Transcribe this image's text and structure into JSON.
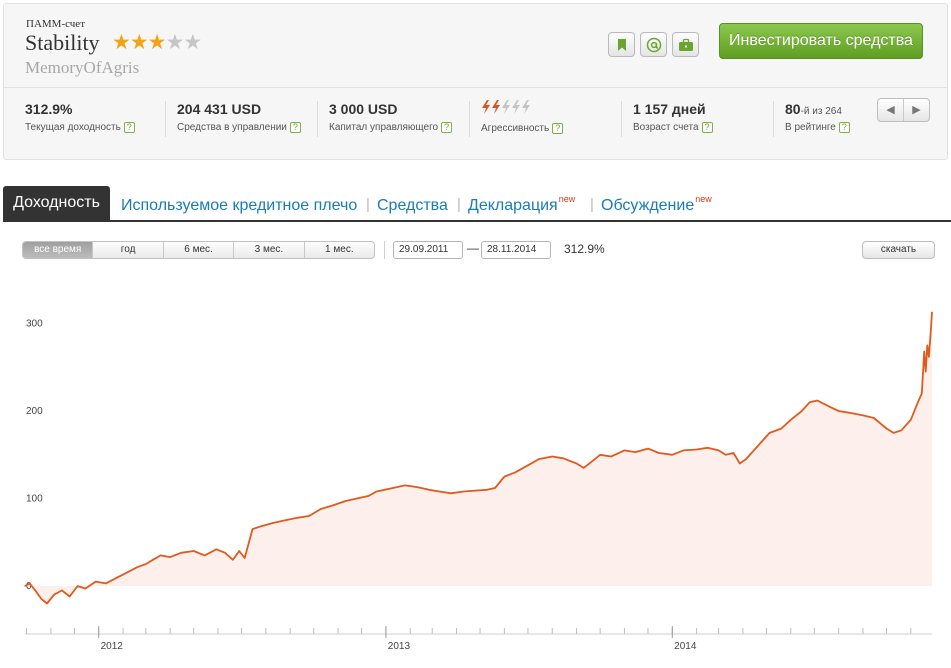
{
  "account": {
    "type_label": "ПАММ-счет",
    "name": "Stability",
    "rating_stars": 3,
    "rating_max": 5,
    "owner": "MemoryOfAgris"
  },
  "actions": {
    "invest_label": "Инвестировать средства",
    "icons": [
      "bookmark-icon",
      "at-icon",
      "briefcase-icon"
    ]
  },
  "metrics": [
    {
      "value": "312.9%",
      "label": "Текущая доходность"
    },
    {
      "value": "204 431 USD",
      "label": "Средства в управлении"
    },
    {
      "value": "3 000 USD",
      "label": "Капитал управляющего"
    },
    {
      "value": "",
      "label": "Агрессивность",
      "aggressiveness_level": 2,
      "aggressiveness_max": 5
    },
    {
      "value": "1 157 дней",
      "label": "Возраст счета"
    },
    {
      "value": "80",
      "value_suffix": "-й из 264",
      "label": "В рейтинге"
    }
  ],
  "pager": {
    "prev": "◀",
    "next": "▶"
  },
  "tabs": {
    "active": "Доходность",
    "items": [
      {
        "label": "Используемое кредитное плечо",
        "badge": ""
      },
      {
        "label": "Средства",
        "badge": ""
      },
      {
        "label": "Декларация",
        "badge": "new"
      },
      {
        "label": "Обсуждение",
        "badge": "new"
      }
    ]
  },
  "controls": {
    "periods": [
      "все время",
      "год",
      "6 мес.",
      "3 мес.",
      "1 мес."
    ],
    "active_period": "все время",
    "date_from": "29.09.2011",
    "date_to": "28.11.2014",
    "date_separator": "—",
    "range_yield": "312.9%",
    "download_label": "скачать"
  },
  "colors": {
    "accent_green": "#6aa52f",
    "line": "#e05a1e",
    "area": "#fdf0ec",
    "link": "#1a7bb9",
    "star_on": "#f0a418",
    "aggr_on": "#d9541e"
  },
  "chart_data": {
    "type": "area",
    "x_unit": "date",
    "y_unit": "%",
    "xlim": [
      "2011-09-29",
      "2014-11-28"
    ],
    "ylim": [
      -50,
      340
    ],
    "y_ticks": [
      0,
      100,
      200,
      300
    ],
    "x_ticks": [
      {
        "label": "2012",
        "date": "2012-01-01"
      },
      {
        "label": "2013",
        "date": "2013-01-01"
      },
      {
        "label": "2014",
        "date": "2014-01-01"
      }
    ],
    "grid": false,
    "legend": "none",
    "series": [
      {
        "points": [
          [
            "2011-09-29",
            0
          ],
          [
            "2011-10-05",
            3
          ],
          [
            "2011-10-12",
            -5
          ],
          [
            "2011-10-20",
            -15
          ],
          [
            "2011-10-27",
            -20
          ],
          [
            "2011-11-05",
            -10
          ],
          [
            "2011-11-15",
            -5
          ],
          [
            "2011-11-25",
            -12
          ],
          [
            "2011-12-05",
            0
          ],
          [
            "2011-12-15",
            -3
          ],
          [
            "2011-12-28",
            5
          ],
          [
            "2012-01-10",
            3
          ],
          [
            "2012-01-25",
            10
          ],
          [
            "2012-02-05",
            15
          ],
          [
            "2012-02-20",
            22
          ],
          [
            "2012-03-01",
            25
          ],
          [
            "2012-03-10",
            30
          ],
          [
            "2012-03-20",
            35
          ],
          [
            "2012-04-01",
            33
          ],
          [
            "2012-04-15",
            38
          ],
          [
            "2012-05-01",
            40
          ],
          [
            "2012-05-15",
            35
          ],
          [
            "2012-05-30",
            42
          ],
          [
            "2012-06-10",
            38
          ],
          [
            "2012-06-20",
            30
          ],
          [
            "2012-06-28",
            40
          ],
          [
            "2012-07-05",
            32
          ],
          [
            "2012-07-15",
            65
          ],
          [
            "2012-07-25",
            68
          ],
          [
            "2012-08-10",
            72
          ],
          [
            "2012-08-25",
            75
          ],
          [
            "2012-09-10",
            78
          ],
          [
            "2012-09-25",
            80
          ],
          [
            "2012-10-10",
            88
          ],
          [
            "2012-10-25",
            92
          ],
          [
            "2012-11-10",
            97
          ],
          [
            "2012-11-25",
            100
          ],
          [
            "2012-12-10",
            103
          ],
          [
            "2012-12-20",
            108
          ],
          [
            "2013-01-10",
            112
          ],
          [
            "2013-01-25",
            115
          ],
          [
            "2013-02-10",
            113
          ],
          [
            "2013-02-25",
            110
          ],
          [
            "2013-03-10",
            108
          ],
          [
            "2013-03-25",
            106
          ],
          [
            "2013-04-10",
            108
          ],
          [
            "2013-04-25",
            109
          ],
          [
            "2013-05-10",
            110
          ],
          [
            "2013-05-20",
            112
          ],
          [
            "2013-06-01",
            125
          ],
          [
            "2013-06-15",
            130
          ],
          [
            "2013-07-01",
            138
          ],
          [
            "2013-07-15",
            145
          ],
          [
            "2013-08-01",
            148
          ],
          [
            "2013-08-15",
            146
          ],
          [
            "2013-09-01",
            140
          ],
          [
            "2013-09-10",
            135
          ],
          [
            "2013-09-20",
            142
          ],
          [
            "2013-10-01",
            150
          ],
          [
            "2013-10-15",
            148
          ],
          [
            "2013-11-01",
            155
          ],
          [
            "2013-11-15",
            153
          ],
          [
            "2013-12-01",
            157
          ],
          [
            "2013-12-15",
            152
          ],
          [
            "2014-01-01",
            150
          ],
          [
            "2014-01-15",
            155
          ],
          [
            "2014-02-01",
            156
          ],
          [
            "2014-02-15",
            158
          ],
          [
            "2014-03-01",
            155
          ],
          [
            "2014-03-10",
            150
          ],
          [
            "2014-03-20",
            152
          ],
          [
            "2014-03-28",
            140
          ],
          [
            "2014-04-05",
            145
          ],
          [
            "2014-04-15",
            155
          ],
          [
            "2014-04-25",
            165
          ],
          [
            "2014-05-05",
            175
          ],
          [
            "2014-05-20",
            180
          ],
          [
            "2014-06-01",
            190
          ],
          [
            "2014-06-15",
            200
          ],
          [
            "2014-06-25",
            210
          ],
          [
            "2014-07-05",
            212
          ],
          [
            "2014-07-20",
            205
          ],
          [
            "2014-08-01",
            200
          ],
          [
            "2014-08-15",
            198
          ],
          [
            "2014-09-01",
            195
          ],
          [
            "2014-09-15",
            192
          ],
          [
            "2014-10-01",
            180
          ],
          [
            "2014-10-10",
            175
          ],
          [
            "2014-10-20",
            178
          ],
          [
            "2014-11-01",
            190
          ],
          [
            "2014-11-10",
            210
          ],
          [
            "2014-11-15",
            220
          ],
          [
            "2014-11-18",
            268
          ],
          [
            "2014-11-20",
            245
          ],
          [
            "2014-11-22",
            275
          ],
          [
            "2014-11-24",
            262
          ],
          [
            "2014-11-26",
            285
          ],
          [
            "2014-11-28",
            312.9
          ]
        ]
      }
    ]
  }
}
